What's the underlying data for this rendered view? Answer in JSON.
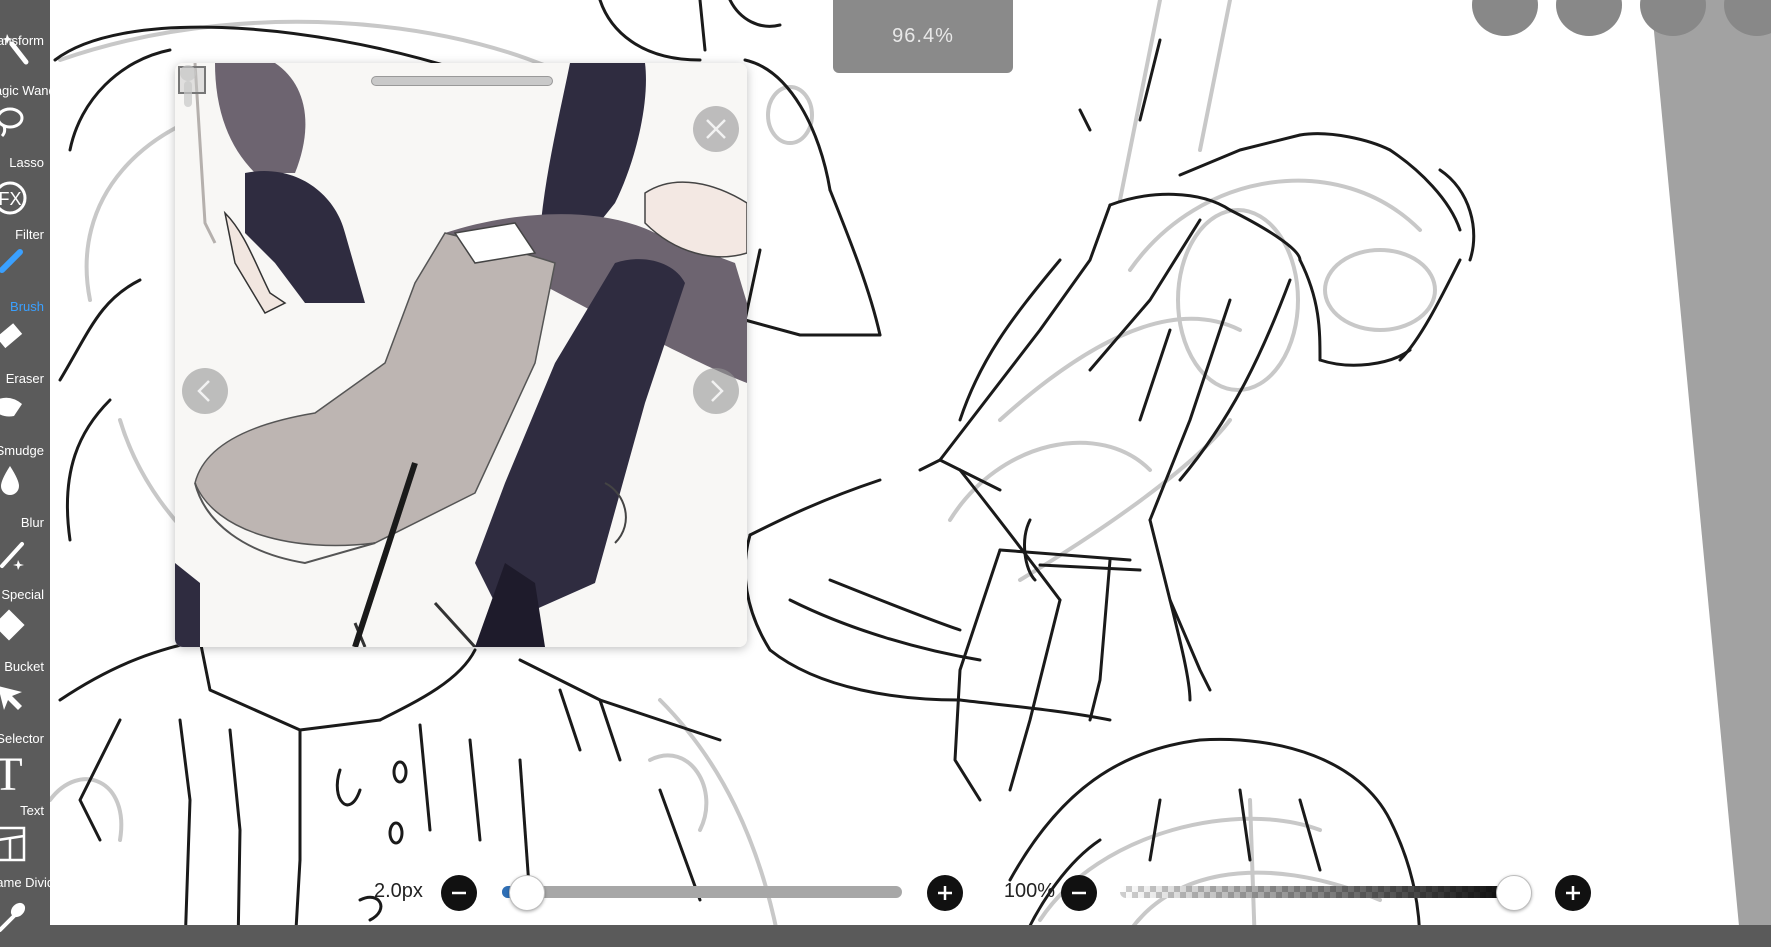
{
  "toolbar": {
    "tools": [
      {
        "label": "Transform",
        "icon": "transform-icon"
      },
      {
        "label": "Magic Wand",
        "icon": "magic-wand-icon"
      },
      {
        "label": "Lasso",
        "icon": "lasso-icon"
      },
      {
        "label": "Filter",
        "icon": "filter-fx-icon"
      },
      {
        "label": "Brush",
        "icon": "brush-icon",
        "active": true
      },
      {
        "label": "Eraser",
        "icon": "eraser-icon"
      },
      {
        "label": "Smudge",
        "icon": "smudge-icon"
      },
      {
        "label": "Blur",
        "icon": "blur-drop-icon"
      },
      {
        "label": "Special",
        "icon": "special-wand-icon"
      },
      {
        "label": "Bucket",
        "icon": "bucket-icon"
      },
      {
        "label": "Selector",
        "icon": "selector-icon"
      },
      {
        "label": "Text",
        "icon": "text-icon"
      },
      {
        "label": "Frame Divider",
        "icon": "frame-divider-icon"
      },
      {
        "label": "Eyedropper",
        "icon": "eyedropper-icon"
      }
    ]
  },
  "filter_icon_text": "FX",
  "text_icon_text": "T",
  "zoom_indicator": "96.4%",
  "brush_size": {
    "value_label": "2.0px",
    "level": 0.02
  },
  "brush_opacity": {
    "value_label": "100%",
    "level": 1.0
  },
  "reference_window": {
    "close_icon": "close-icon",
    "prev_icon": "chevron-left-icon",
    "next_icon": "chevron-right-icon"
  },
  "colors": {
    "toolbar_bg": "#5b5b5b",
    "active_tool": "#3aa0ff",
    "zoom_pill": "#8a8a8a",
    "size_fill": "#2f6fb6",
    "outside_canvas": "#a2a2a2",
    "hair": "#6d6470",
    "jacket": "#2f2c40"
  }
}
